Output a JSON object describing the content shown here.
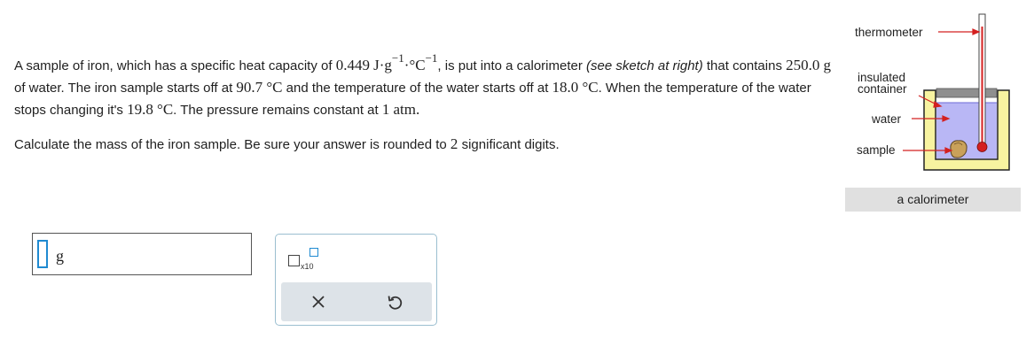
{
  "problem": {
    "p1_a": "A sample of iron, which has a specific heat capacity of ",
    "heat_capacity": "0.449",
    "unit_j": "J",
    "dot": "·",
    "unit_g": "g",
    "exp_neg1": "−1",
    "unit_c": "°C",
    "p1_b": ", is put into a calorimeter ",
    "p1_italic": "(see sketch at right)",
    "p1_c": " that contains ",
    "water_mass": "250.0",
    "g": "g",
    "p1_d": " of water. The iron sample starts off at ",
    "iron_temp": "90.7",
    "degc": "°C",
    "p1_e": " and the temperature of the water starts off at ",
    "water_temp": "18.0",
    "p1_f": ". When the temperature of the water stops changing it's ",
    "final_temp": "19.8",
    "p1_g": ". The pressure remains constant at ",
    "pressure": "1",
    "atm": "atm",
    "period": ".",
    "p2_a": "Calculate the mass of the iron sample. Be sure your answer is rounded to ",
    "sig_figs": "2",
    "p2_b": " significant digits."
  },
  "answer": {
    "value": "",
    "unit": "g"
  },
  "tools": {
    "sci_icon": "scientific-notation-icon",
    "sci_label": "x10",
    "clear_icon": "close-icon",
    "undo_icon": "undo-icon"
  },
  "figure": {
    "thermometer_label": "thermometer",
    "insulated_label_1": "insulated",
    "insulated_label_2": "container",
    "water_label": "water",
    "sample_label": "sample",
    "caption": "a calorimeter"
  },
  "colors": {
    "accent": "#1f8ad1",
    "water": "#b9b7f5",
    "container": "#f7f3a0",
    "arrow": "#d42020"
  }
}
